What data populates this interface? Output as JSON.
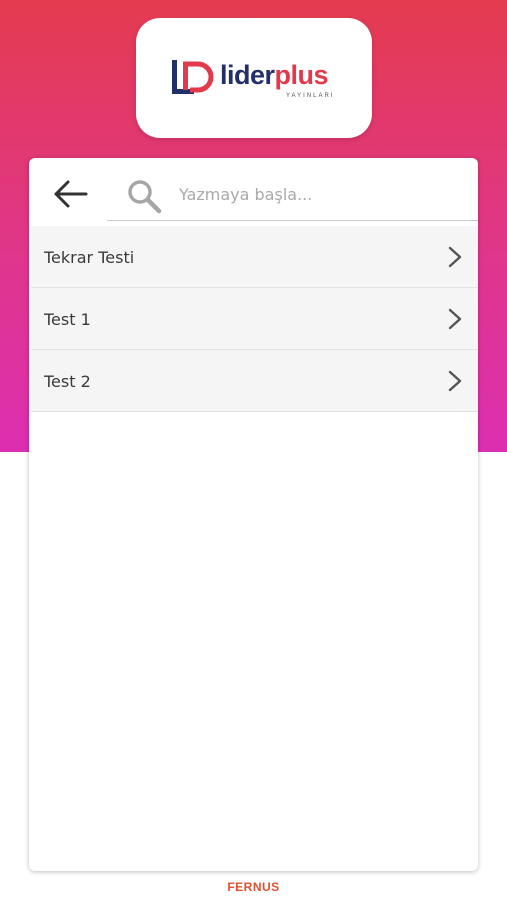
{
  "app": {
    "logo": {
      "name_part1": "lider",
      "name_part2": "plus",
      "subtitle": "YAYINLARI",
      "mark": "LP"
    },
    "footer_brand": "FERNUS"
  },
  "colors": {
    "gradient_top": "#e43b4f",
    "gradient_bottom": "#dc2fb1",
    "logo_navy": "#22306a",
    "logo_red": "#e23a4a",
    "footer_orange": "#e0502f"
  },
  "header": {
    "back_icon": "arrow-left-icon",
    "search": {
      "icon": "search-icon",
      "placeholder": "Yazmaya başla..."
    }
  },
  "tests": [
    {
      "label": "Tekrar Testi",
      "icon": "chevron-right-icon"
    },
    {
      "label": "Test 1",
      "icon": "chevron-right-icon"
    },
    {
      "label": "Test 2",
      "icon": "chevron-right-icon"
    }
  ]
}
